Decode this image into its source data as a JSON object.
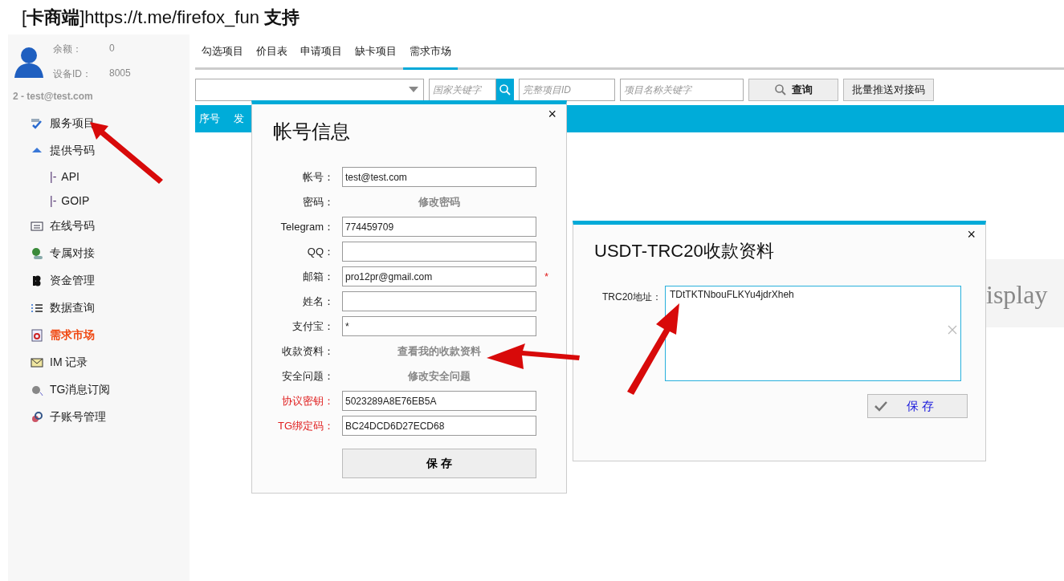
{
  "window": {
    "title": "[**卡商端**]https://t.me/firefox_fun **支持**"
  },
  "account": {
    "balance_label": "余额：",
    "balance": "0",
    "device_label": "设备ID：",
    "device": "8005",
    "user": "2 - test@test.com"
  },
  "sidebar": {
    "items": [
      {
        "label": "服务项目",
        "selected": false
      },
      {
        "label": "提供号码",
        "selected": false,
        "children": [
          {
            "prefix": "|-",
            "label": "API",
            "selected": false
          },
          {
            "prefix": "|-",
            "label": "GOIP",
            "selected": false
          }
        ]
      },
      {
        "label": "在线号码",
        "selected": false
      },
      {
        "label": "专属对接",
        "selected": false
      },
      {
        "label": "资金管理",
        "selected": false
      },
      {
        "label": "数据查询",
        "selected": false
      },
      {
        "label": "需求市场",
        "selected": true
      },
      {
        "label": "IM 记录",
        "selected": false
      },
      {
        "label": "TG消息订阅",
        "selected": false
      },
      {
        "label": "子账号管理",
        "selected": false
      }
    ]
  },
  "tabs": [
    {
      "label": "勾选项目",
      "selected": false
    },
    {
      "label": "价目表",
      "selected": false
    },
    {
      "label": "申请项目",
      "selected": false
    },
    {
      "label": "缺卡项目",
      "selected": false
    },
    {
      "label": "需求市场",
      "selected": true
    }
  ],
  "toolbar": {
    "country_placeholder": "国家关键字",
    "id_placeholder": "完整项目ID",
    "name_placeholder": "项目名称关键字",
    "query_button": "查询",
    "batch_button": "批量推送对接码"
  },
  "table": {
    "columns": [
      "序号",
      "发"
    ]
  },
  "background_text": "isplay",
  "account_dialog": {
    "title": "帐号信息",
    "close": "×",
    "rows": [
      {
        "kind": "field",
        "label": "帐号：",
        "value": "test@test.com",
        "alert": false
      },
      {
        "kind": "link",
        "label": "密码：",
        "value": "修改密码",
        "alert": false
      },
      {
        "kind": "field",
        "label": "Telegram：",
        "value": "774459709",
        "alert": false
      },
      {
        "kind": "field",
        "label": "QQ：",
        "value": "",
        "alert": false
      },
      {
        "kind": "field",
        "label": "邮箱：",
        "value": "pro12pr@gmail.com",
        "alert": false,
        "marker": "*"
      },
      {
        "kind": "field",
        "label": "姓名：",
        "value": "",
        "alert": false
      },
      {
        "kind": "field",
        "label": "支付宝：",
        "value": "*",
        "alert": false
      },
      {
        "kind": "link",
        "label": "收款资料：",
        "value": "查看我的收款资料",
        "alert": false
      },
      {
        "kind": "link",
        "label": "安全问题：",
        "value": "修改安全问题",
        "alert": false
      },
      {
        "kind": "field",
        "label": "协议密钥：",
        "value": "5023289A8E76EB5A",
        "alert": true
      },
      {
        "kind": "field",
        "label": "TG绑定码：",
        "value": "BC24DCD6D27ECD68",
        "alert": true
      }
    ],
    "save_button": "保 存"
  },
  "payment_dialog": {
    "title": "USDT-TRC20收款资料",
    "close": "×",
    "label": "TRC20地址：",
    "value": "TDtTKTNbouFLKYu4jdrXheh",
    "save_button": "保 存"
  }
}
